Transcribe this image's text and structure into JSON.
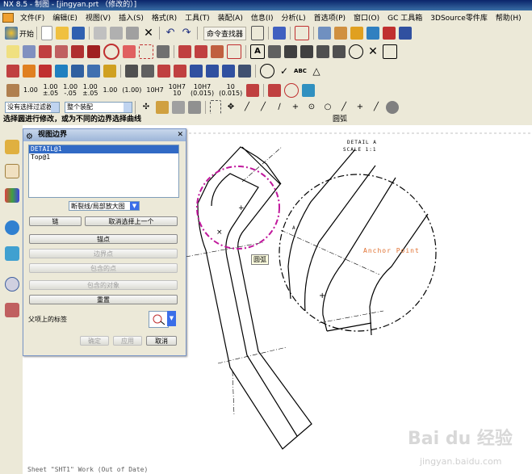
{
  "window": {
    "title": "NX 8.5 - 制图 - [jingyan.prt （修改的）]"
  },
  "menu": [
    "文件(F)",
    "编辑(E)",
    "视图(V)",
    "插入(S)",
    "格式(R)",
    "工具(T)",
    "装配(A)",
    "信息(I)",
    "分析(L)",
    "首选项(P)",
    "窗口(O)",
    "GC 工具箱",
    "3DSource零件库",
    "帮助(H)"
  ],
  "toolbar": {
    "start_label": "开始",
    "command_finder": "命令查找器",
    "num_buttons": [
      "1.00",
      "1.00\n±.05",
      "1.00\n-.05",
      "1.00\n±.05",
      "1.00",
      "(1.00)",
      "10H7",
      "10H7\n10",
      "10H7\n(0.015)",
      "10\n(0.015)"
    ],
    "selection_filter": "没有选择过滤器",
    "assembly_scope": "整个装配"
  },
  "cue": {
    "prompt": "选择圆进行修改，或为不同的边界选择曲线",
    "status": "圆弧"
  },
  "dialog": {
    "title": "视图边界",
    "list_items": [
      "DETAIL@1",
      "Top@1"
    ],
    "selected_index": 0,
    "boundary_type": "断裂线/局部放大图",
    "chain_label": "链",
    "cancel_prev_label": "取消选择上一个",
    "anchor_label": "锚点",
    "boundary_point_label": "边界点",
    "included_point_label": "包含的点",
    "included_object_label": "包含的对象",
    "reset_label": "重置",
    "parent_label_text": "父项上的标签",
    "ok_label": "确定",
    "apply_label": "应用",
    "cancel_label": "取消"
  },
  "drawing": {
    "detail_label": "DETAIL A",
    "scale_label": "SCALE 1:1",
    "anchor_point_text": "Anchor Point",
    "tooltip": "圆弧",
    "sheet_status": "Sheet \"SHT1\" Work (Out of Date)",
    "label_a": "A"
  },
  "watermark": {
    "text": "Bai du 经验",
    "url": "jingyan.baidu.com"
  },
  "colors": {
    "selection_circle": "#c0189c",
    "anchor": "#e07030",
    "titlebar": "#0a246a"
  }
}
